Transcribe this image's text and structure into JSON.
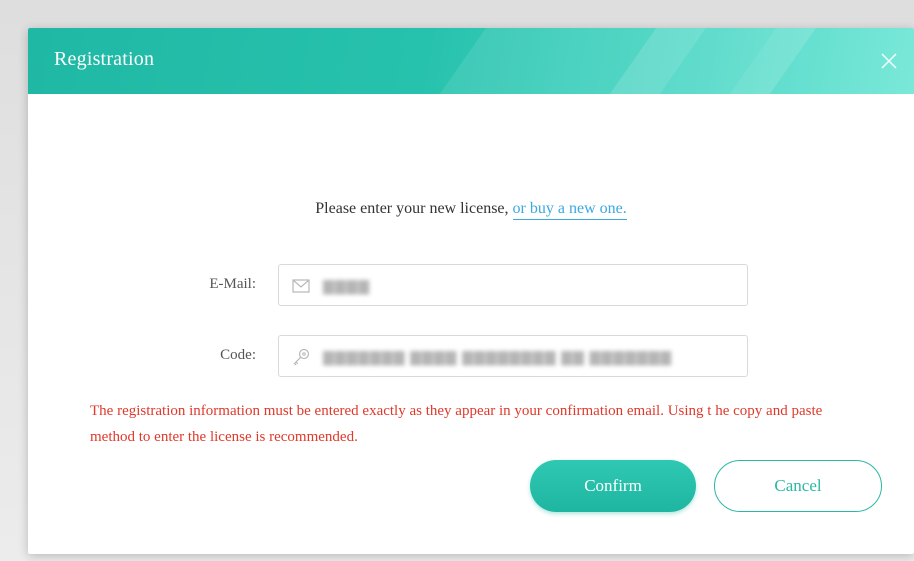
{
  "dialog": {
    "title": "Registration"
  },
  "prompt": {
    "text": "Please enter your new license,",
    "link": "or buy a new one."
  },
  "email": {
    "label": "E-Mail:",
    "value": "▇▇▇▇"
  },
  "code": {
    "label": "Code:",
    "value": "▇▇▇▇▇▇▇ ▇▇▇▇ ▇▇▇▇▇▇▇▇ ▇▇ ▇▇▇▇▇▇▇"
  },
  "warning": "The registration information must be entered exactly as they appear in your confirmation email. Using t he copy and paste method to enter the license is recommended.",
  "buttons": {
    "confirm": "Confirm",
    "cancel": "Cancel"
  },
  "colors": {
    "accent": "#1fb8a4",
    "link": "#3aa9e0",
    "warning": "#e0392b"
  },
  "icons": {
    "close": "close-icon",
    "email": "mail-icon",
    "code": "key-icon"
  }
}
